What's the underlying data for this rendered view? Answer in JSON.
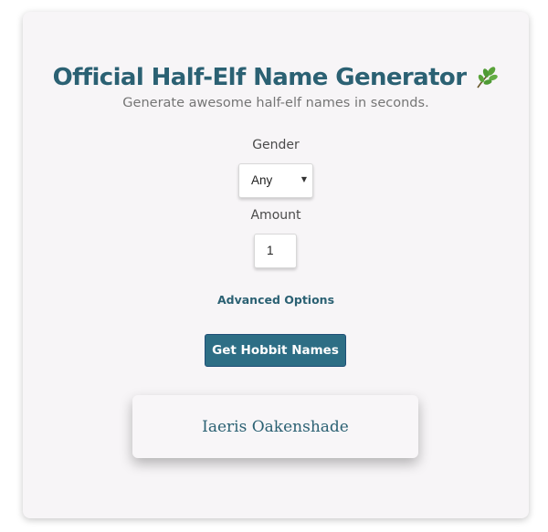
{
  "header": {
    "title": "Official Half-Elf Name Generator",
    "title_icon": "leaf-icon",
    "subtitle": "Generate awesome half-elf names in seconds."
  },
  "form": {
    "gender_label": "Gender",
    "gender_value": "Any",
    "amount_label": "Amount",
    "amount_value": "1",
    "advanced_options": "Advanced Options",
    "generate_button": "Get Hobbit Names"
  },
  "results": {
    "names": [
      "Iaeris Oakenshade"
    ]
  },
  "colors": {
    "accent": "#2b6173",
    "button": "#2d6e85",
    "card_bg": "#f7f5f7",
    "leaf_green": "#5aa33a"
  }
}
